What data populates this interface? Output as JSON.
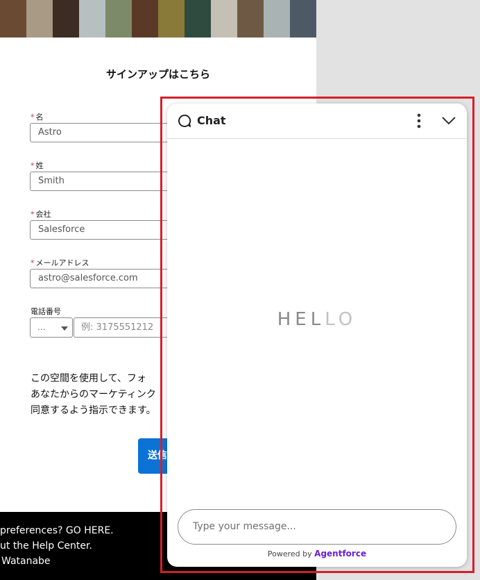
{
  "form": {
    "title": "サインアップはこちら",
    "fields": [
      {
        "label": "名",
        "value": "Astro",
        "required": true
      },
      {
        "label": "姓",
        "value": "Smith",
        "required": true
      },
      {
        "label": "会社",
        "value": "Salesforce",
        "required": true
      },
      {
        "label": "メールアドレス",
        "value": "astro@salesforce.com",
        "required": true
      }
    ],
    "phone": {
      "label": "電話番号",
      "country_value": "...",
      "placeholder": "例: 3175551212"
    },
    "consent_lines": [
      "この空間を使用して、フォ",
      "あなたからのマーケティンク",
      "同意するよう指示できます。"
    ],
    "submit_label": "送信"
  },
  "footer": {
    "lines": [
      "preferences? GO HERE.",
      "ut the Help Center.",
      "Watanabe"
    ]
  },
  "chat": {
    "title": "Chat",
    "hello_dark": "HEL",
    "hello_light": "LO",
    "input_placeholder": "Type your message...",
    "powered_by": "Powered by",
    "brand": "Agentforce",
    "brand_color": "#6a1ed6"
  },
  "colors": {
    "highlight_border": "#d51f2a",
    "submit_button": "#0b72d6",
    "required_mark": "#c23934"
  }
}
